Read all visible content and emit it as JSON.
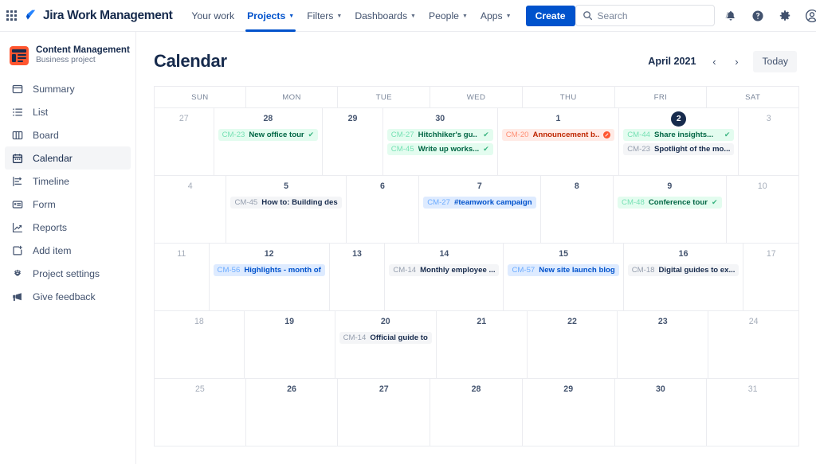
{
  "topnav": {
    "app_switcher_icon": "grid-apps-icon",
    "brand": "Jira Work Management",
    "items": [
      {
        "label": "Your work",
        "has_caret": false,
        "active": false
      },
      {
        "label": "Projects",
        "has_caret": true,
        "active": true
      },
      {
        "label": "Filters",
        "has_caret": true,
        "active": false
      },
      {
        "label": "Dashboards",
        "has_caret": true,
        "active": false
      },
      {
        "label": "People",
        "has_caret": true,
        "active": false
      },
      {
        "label": "Apps",
        "has_caret": true,
        "active": false
      }
    ],
    "create_label": "Create",
    "search": {
      "placeholder": "Search",
      "value": "",
      "shortcut": "/"
    },
    "icons": [
      "notifications-bell-icon",
      "help-icon",
      "settings-gear-icon",
      "account-avatar-icon"
    ]
  },
  "sidebar": {
    "project": {
      "name": "Content Management",
      "type": "Business project",
      "icon": "content-project-icon"
    },
    "items": [
      {
        "label": "Summary",
        "icon": "summary-icon",
        "active": false
      },
      {
        "label": "List",
        "icon": "list-icon",
        "active": false
      },
      {
        "label": "Board",
        "icon": "board-icon",
        "active": false
      },
      {
        "label": "Calendar",
        "icon": "calendar-icon",
        "active": true
      },
      {
        "label": "Timeline",
        "icon": "timeline-icon",
        "active": false
      },
      {
        "label": "Form",
        "icon": "form-icon",
        "active": false
      },
      {
        "label": "Reports",
        "icon": "reports-icon",
        "active": false
      },
      {
        "label": "Add item",
        "icon": "add-item-icon",
        "active": false
      },
      {
        "label": "Project settings",
        "icon": "gear-icon",
        "active": false
      },
      {
        "label": "Give feedback",
        "icon": "megaphone-icon",
        "active": false
      }
    ]
  },
  "main": {
    "title": "Calendar",
    "month_label": "April 2021",
    "prev_label": "‹",
    "next_label": "›",
    "today_label": "Today",
    "weekday_headers": [
      "SUN",
      "MON",
      "TUE",
      "WED",
      "THU",
      "FRI",
      "SAT"
    ],
    "colors": {
      "brand_blue": "#0052cc",
      "green_bg": "#e3fcef",
      "green_text": "#006644",
      "blue_bg": "#deebff",
      "blue_text": "#0052cc",
      "grey_bg": "#f4f5f7",
      "grey_text": "#172b4d",
      "red_bg": "#ffebe6",
      "red_text": "#bf2600",
      "today_circle": "#172b4d"
    },
    "weeks": [
      [
        {
          "num": "27",
          "muted": true,
          "today": false,
          "events": []
        },
        {
          "num": "28",
          "muted": false,
          "today": false,
          "events": [
            {
              "key": "CM-23",
              "summary": "New office tour",
              "color": "green",
              "status": "done"
            }
          ]
        },
        {
          "num": "29",
          "muted": false,
          "today": false,
          "events": []
        },
        {
          "num": "30",
          "muted": false,
          "today": false,
          "events": [
            {
              "key": "CM-27",
              "summary": "Hitchhiker's gu..",
              "color": "green",
              "status": "done"
            },
            {
              "key": "CM-45",
              "summary": "Write up works...",
              "color": "green",
              "status": "done"
            }
          ]
        },
        {
          "num": "1",
          "muted": false,
          "today": false,
          "events": [
            {
              "key": "CM-20",
              "summary": "Announcement b..",
              "color": "red",
              "status": "blocked"
            }
          ]
        },
        {
          "num": "2",
          "muted": false,
          "today": true,
          "events": [
            {
              "key": "CM-44",
              "summary": "Share insights...",
              "color": "green",
              "status": "done"
            },
            {
              "key": "CM-23",
              "summary": "Spotlight of the mo...",
              "color": "grey",
              "status": "none"
            }
          ]
        },
        {
          "num": "3",
          "muted": true,
          "today": false,
          "events": []
        }
      ],
      [
        {
          "num": "4",
          "muted": true,
          "today": false,
          "events": []
        },
        {
          "num": "5",
          "muted": false,
          "today": false,
          "events": [
            {
              "key": "CM-45",
              "summary": "How to: Building des",
              "color": "grey",
              "status": "none"
            }
          ]
        },
        {
          "num": "6",
          "muted": false,
          "today": false,
          "events": []
        },
        {
          "num": "7",
          "muted": false,
          "today": false,
          "events": [
            {
              "key": "CM-27",
              "summary": "#teamwork campaign",
              "color": "blue",
              "status": "none"
            }
          ]
        },
        {
          "num": "8",
          "muted": false,
          "today": false,
          "events": []
        },
        {
          "num": "9",
          "muted": false,
          "today": false,
          "events": [
            {
              "key": "CM-48",
              "summary": "Conference tour",
              "color": "green",
              "status": "done"
            }
          ]
        },
        {
          "num": "10",
          "muted": true,
          "today": false,
          "events": []
        }
      ],
      [
        {
          "num": "11",
          "muted": true,
          "today": false,
          "events": []
        },
        {
          "num": "12",
          "muted": false,
          "today": false,
          "events": [
            {
              "key": "CM-56",
              "summary": "Highlights - month of",
              "color": "blue",
              "status": "none"
            }
          ]
        },
        {
          "num": "13",
          "muted": false,
          "today": false,
          "events": []
        },
        {
          "num": "14",
          "muted": false,
          "today": false,
          "events": [
            {
              "key": "CM-14",
              "summary": "Monthly employee ...",
              "color": "grey",
              "status": "none"
            }
          ]
        },
        {
          "num": "15",
          "muted": false,
          "today": false,
          "events": [
            {
              "key": "CM-57",
              "summary": "New site launch blog",
              "color": "blue",
              "status": "none"
            }
          ]
        },
        {
          "num": "16",
          "muted": false,
          "today": false,
          "events": [
            {
              "key": "CM-18",
              "summary": "Digital guides to ex...",
              "color": "grey",
              "status": "none"
            }
          ]
        },
        {
          "num": "17",
          "muted": true,
          "today": false,
          "events": []
        }
      ],
      [
        {
          "num": "18",
          "muted": true,
          "today": false,
          "events": []
        },
        {
          "num": "19",
          "muted": false,
          "today": false,
          "events": []
        },
        {
          "num": "20",
          "muted": false,
          "today": false,
          "events": [
            {
              "key": "CM-14",
              "summary": "Official guide to",
              "color": "grey",
              "status": "none"
            }
          ]
        },
        {
          "num": "21",
          "muted": false,
          "today": false,
          "events": []
        },
        {
          "num": "22",
          "muted": false,
          "today": false,
          "events": []
        },
        {
          "num": "23",
          "muted": false,
          "today": false,
          "events": []
        },
        {
          "num": "24",
          "muted": true,
          "today": false,
          "events": []
        }
      ],
      [
        {
          "num": "25",
          "muted": true,
          "today": false,
          "events": []
        },
        {
          "num": "26",
          "muted": false,
          "today": false,
          "events": []
        },
        {
          "num": "27",
          "muted": false,
          "today": false,
          "events": []
        },
        {
          "num": "28",
          "muted": false,
          "today": false,
          "events": []
        },
        {
          "num": "29",
          "muted": false,
          "today": false,
          "events": []
        },
        {
          "num": "30",
          "muted": false,
          "today": false,
          "events": []
        },
        {
          "num": "31",
          "muted": true,
          "today": false,
          "events": []
        }
      ]
    ]
  }
}
